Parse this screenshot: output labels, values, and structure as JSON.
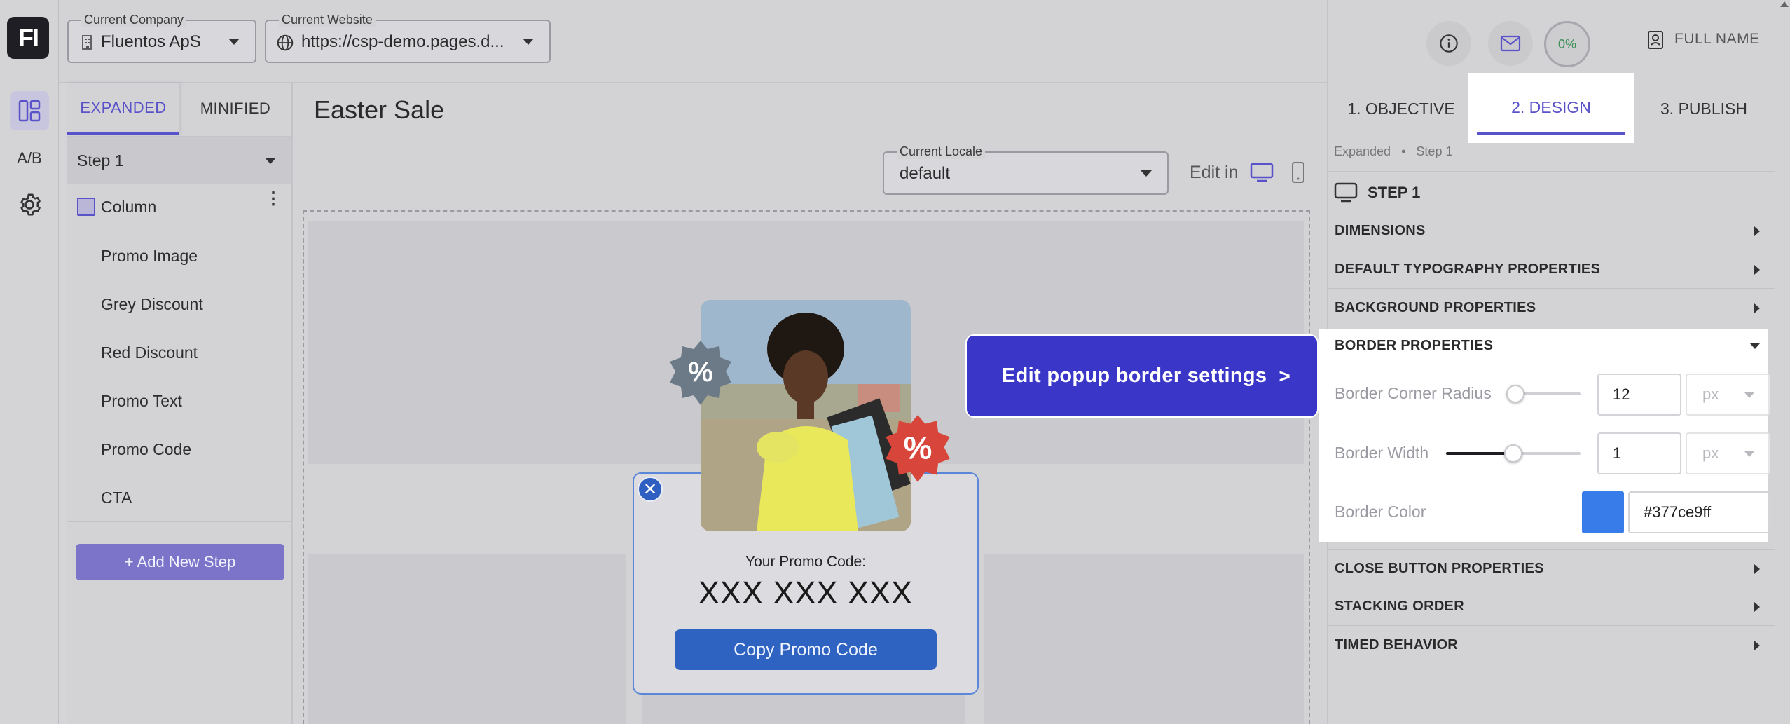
{
  "header": {
    "company": {
      "label": "Current Company",
      "value": "Fluentos ApS"
    },
    "website": {
      "label": "Current Website",
      "value": "https://csp-demo.pages.d..."
    },
    "progress_pct": "0%",
    "user_name": "FULL NAME"
  },
  "rail": {
    "logo": "FI",
    "ab_label": "A/B"
  },
  "left_panel": {
    "tabs": [
      {
        "label": "EXPANDED",
        "active": true
      },
      {
        "label": "MINIFIED",
        "active": false
      }
    ],
    "step_select": "Step 1",
    "tree": {
      "root": "Column",
      "children": [
        "Promo Image",
        "Grey Discount",
        "Red Discount",
        "Promo Text",
        "Promo Code",
        "CTA"
      ]
    },
    "add_step_label": "+ Add New Step"
  },
  "canvas": {
    "title": "Easter Sale",
    "locale": {
      "label": "Current Locale",
      "value": "default"
    },
    "edit_in_label": "Edit in",
    "popup": {
      "promo_label": "Your Promo Code:",
      "promo_code": "XXX XXX XXX",
      "cta_label": "Copy Promo Code",
      "close_symbol": "✕",
      "badge_symbol": "%"
    }
  },
  "callout": {
    "text": "Edit popup border settings",
    "arrow": ">"
  },
  "right_panel": {
    "tabs": [
      {
        "label": "1. OBJECTIVE",
        "active": false
      },
      {
        "label": "2. DESIGN",
        "active": true
      },
      {
        "label": "3. PUBLISH",
        "active": false
      }
    ],
    "breadcrumb": {
      "root": "Expanded",
      "separator": "•",
      "current": "Step 1"
    },
    "step_heading": "STEP 1",
    "sections": {
      "dimensions": "DIMENSIONS",
      "typography": "DEFAULT TYPOGRAPHY PROPERTIES",
      "background": "BACKGROUND PROPERTIES",
      "border": "BORDER PROPERTIES",
      "close_button": "CLOSE BUTTON PROPERTIES",
      "stacking": "STACKING ORDER",
      "timed": "TIMED BEHAVIOR"
    },
    "border": {
      "corner_radius": {
        "label": "Border Corner Radius",
        "value": "12",
        "unit": "px",
        "slider_fraction": 0.0
      },
      "width": {
        "label": "Border Width",
        "value": "1",
        "unit": "px",
        "slider_fraction": 0.5
      },
      "color": {
        "label": "Border Color",
        "value": "#377ce9ff",
        "swatch": "#377ce9"
      }
    }
  },
  "colors": {
    "accent": "#3a36c7",
    "active_tab": "#5a52c9",
    "cta_blue": "#2f63c2",
    "badge_red": "#d8453a",
    "badge_grey": "#6c7a88"
  }
}
